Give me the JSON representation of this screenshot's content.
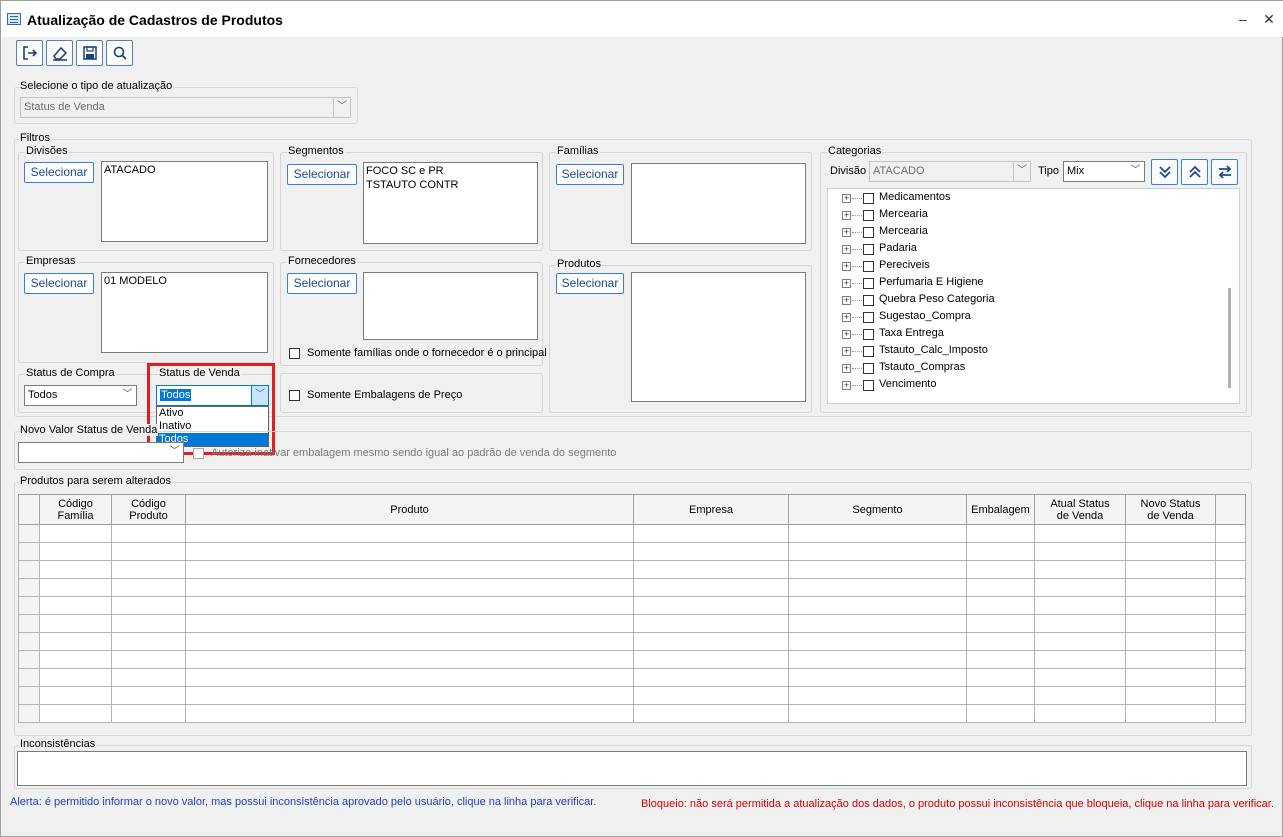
{
  "window": {
    "title": "Atualização de Cadastros de Produtos",
    "minimize": "–",
    "close": "✕"
  },
  "toolbar": {
    "icons": [
      "exit-icon",
      "eraser-icon",
      "save-icon",
      "search-icon"
    ]
  },
  "update_type": {
    "label": "Selecione o tipo de atualização",
    "value": "Status de Venda"
  },
  "filters": {
    "label": "Filtros",
    "divisoes": {
      "label": "Divisões",
      "button": "Selecionar",
      "items": "ATACADO"
    },
    "segmentos": {
      "label": "Segmentos",
      "button": "Selecionar",
      "items": "FOCO SC e PR\nTSTAUTO CONTR"
    },
    "familias": {
      "label": "Famílias",
      "button": "Selecionar",
      "items": ""
    },
    "empresas": {
      "label": "Empresas",
      "button": "Selecionar",
      "items": "01 MODELO"
    },
    "fornecedores": {
      "label": "Fornecedores",
      "button": "Selecionar",
      "items": "",
      "checkbox_label": "Somente famílias onde o fornecedor é o principal"
    },
    "produtos": {
      "label": "Produtos",
      "button": "Selecionar",
      "items": ""
    },
    "status_compra": {
      "label": "Status de Compra",
      "value": "Todos"
    },
    "status_venda": {
      "label": "Status de Venda",
      "value": "Todos",
      "options": [
        "Ativo",
        "Inativo",
        "Todos"
      ]
    },
    "embalagens": {
      "checkbox_label": "Somente Embalagens de Preço"
    },
    "categorias": {
      "label": "Categorias",
      "divisao_label": "Divisão",
      "divisao_value": "ATACADO",
      "tipo_label": "Tipo",
      "tipo_value": "Mix",
      "tree": [
        "Medicamentos",
        "Mercearia",
        "Mercearia",
        "Padaria",
        "Pereciveis",
        "Perfumaria E Higiene",
        "Quebra Peso Categoria",
        "Sugestao_Compra",
        "Taxa Entrega",
        "Tstauto_Calc_Imposto",
        "Tstauto_Compras",
        "Vencimento"
      ]
    }
  },
  "novo_valor": {
    "label": "Novo Valor Status de Venda",
    "checkbox_label": "Autoriza inativar embalagem mesmo sendo igual ao padrão de venda do segmento"
  },
  "produtos_grid": {
    "label": "Produtos para serem alterados",
    "columns": [
      "Código\nFamília",
      "Código\nProduto",
      "Produto",
      "Empresa",
      "Segmento",
      "Embalagem",
      "Atual Status\nde Venda",
      "Novo Status\nde Venda"
    ]
  },
  "inconsistencias": {
    "label": "Inconsistências"
  },
  "footer": {
    "alert": "Alerta: é permitido informar o novo valor, mas possui inconsistência aprovado pelo usuário, clique na linha para verificar.",
    "block": "Bloqueio: não será permitida a atualização dos dados, o produto possui inconsistência que bloqueia, clique na linha para verificar."
  },
  "colors": {
    "accent": "#3b7fd1",
    "highlight": "#0078d7",
    "annotation": "#e02020",
    "alert": "#1c3fc4",
    "block": "#d40000"
  }
}
